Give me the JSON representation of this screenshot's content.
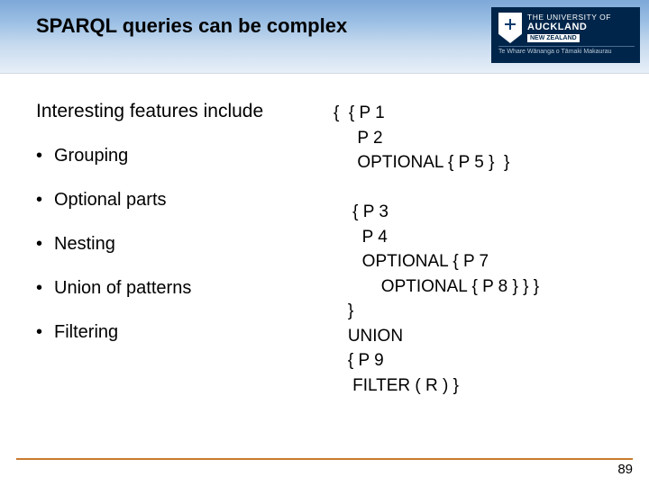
{
  "header": {
    "title": "SPARQL queries can be complex",
    "logo": {
      "line1": "THE UNIVERSITY OF",
      "line2": "AUCKLAND",
      "tag": "NEW ZEALAND",
      "maori": "Te Whare Wānanga o Tāmaki Makaurau"
    }
  },
  "left": {
    "intro": "Interesting features include",
    "items": [
      "Grouping",
      "Optional parts",
      "Nesting",
      "Union of patterns",
      "Filtering"
    ]
  },
  "code": "{  { P 1\n     P 2\n     OPTIONAL { P 5 }  }\n\n    { P 3\n      P 4\n      OPTIONAL { P 7\n          OPTIONAL { P 8 } } }\n   }\n   UNION\n   { P 9\n    FILTER ( R ) }",
  "footer": {
    "page": "89"
  }
}
